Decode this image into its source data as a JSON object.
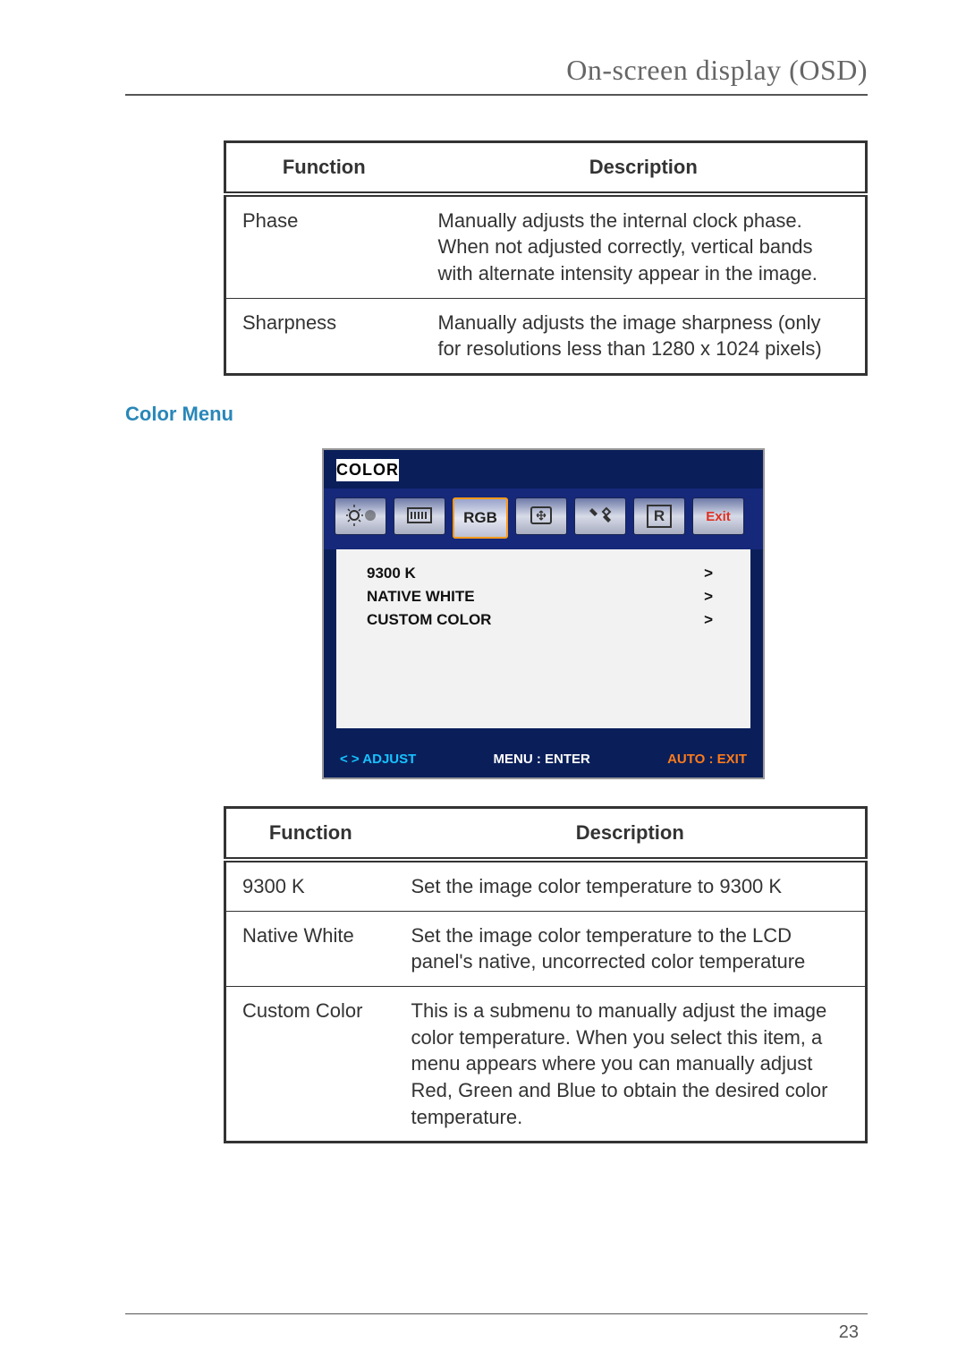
{
  "header": {
    "title": "On-screen display (OSD)"
  },
  "table1": {
    "headers": {
      "function": "Function",
      "description": "Description"
    },
    "rows": [
      {
        "function": "Phase",
        "description": "Manually adjusts the internal clock phase. When not adjusted correctly, vertical bands with alternate intensity appear in the image."
      },
      {
        "function": "Sharpness",
        "description": "Manually adjusts the image sharpness (only for resolutions less than 1280 x 1024 pixels)"
      }
    ]
  },
  "section": {
    "color_menu_title": "Color Menu"
  },
  "osd": {
    "title": "COLOR",
    "tabs": {
      "brightness": "brightness-contrast-icon",
      "image": "image-adjust-icon",
      "rgb": "RGB",
      "position": "position-icon",
      "tools": "tools-icon",
      "reset": "R",
      "exit": "Exit"
    },
    "items": [
      {
        "label": "9300 K",
        "arrow": ">"
      },
      {
        "label": "NATIVE WHITE",
        "arrow": ">"
      },
      {
        "label": "CUSTOM COLOR",
        "arrow": ">"
      }
    ],
    "footer": {
      "adjust": "< > ADJUST",
      "menu": "MENU : ENTER",
      "auto": "AUTO : EXIT"
    }
  },
  "table2": {
    "headers": {
      "function": "Function",
      "description": "Description"
    },
    "rows": [
      {
        "function": "9300 K",
        "description": "Set the image color temperature to 9300 K"
      },
      {
        "function": "Native White",
        "description": "Set the image color temperature to the LCD panel's native, uncorrected color temperature"
      },
      {
        "function": "Custom Color",
        "description": "This is a submenu to manually adjust the image color temperature. When you select this item, a menu appears where you can manually adjust Red, Green and Blue to obtain the desired color temperature."
      }
    ]
  },
  "page": {
    "number": "23"
  }
}
